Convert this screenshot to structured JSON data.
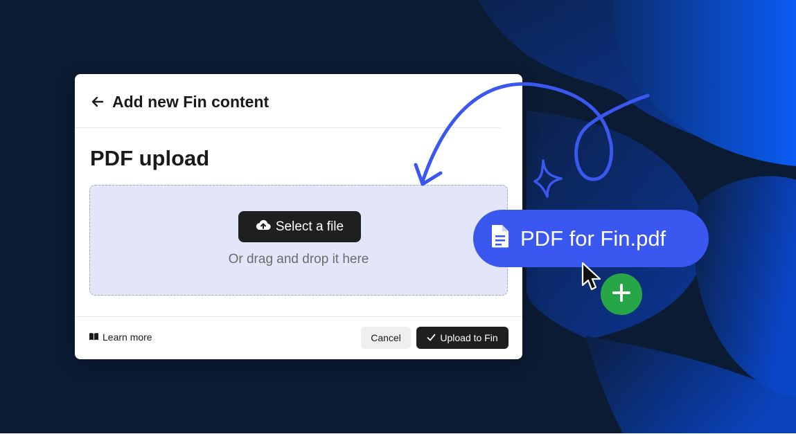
{
  "dialog": {
    "title": "Add new Fin content",
    "section_title": "PDF upload",
    "select_file_label": "Select a file",
    "drop_hint": "Or drag and drop it here",
    "learn_more_label": "Learn more",
    "cancel_label": "Cancel",
    "upload_label": "Upload to Fin"
  },
  "dragged_file": {
    "name": "PDF for Fin.pdf"
  },
  "icons": {
    "back": "arrow-left-icon",
    "upload": "cloud-upload-icon",
    "book": "book-icon",
    "check": "check-icon",
    "file": "document-icon",
    "cursor": "mouse-pointer-icon",
    "plus": "plus-icon",
    "sparkle": "sparkle-icon"
  },
  "colors": {
    "background": "#0b1b33",
    "accent_blue": "#3a57f0",
    "dropzone_bg": "#e3e6f8",
    "button_dark": "#1f1f1f",
    "add_green": "#26a646"
  }
}
